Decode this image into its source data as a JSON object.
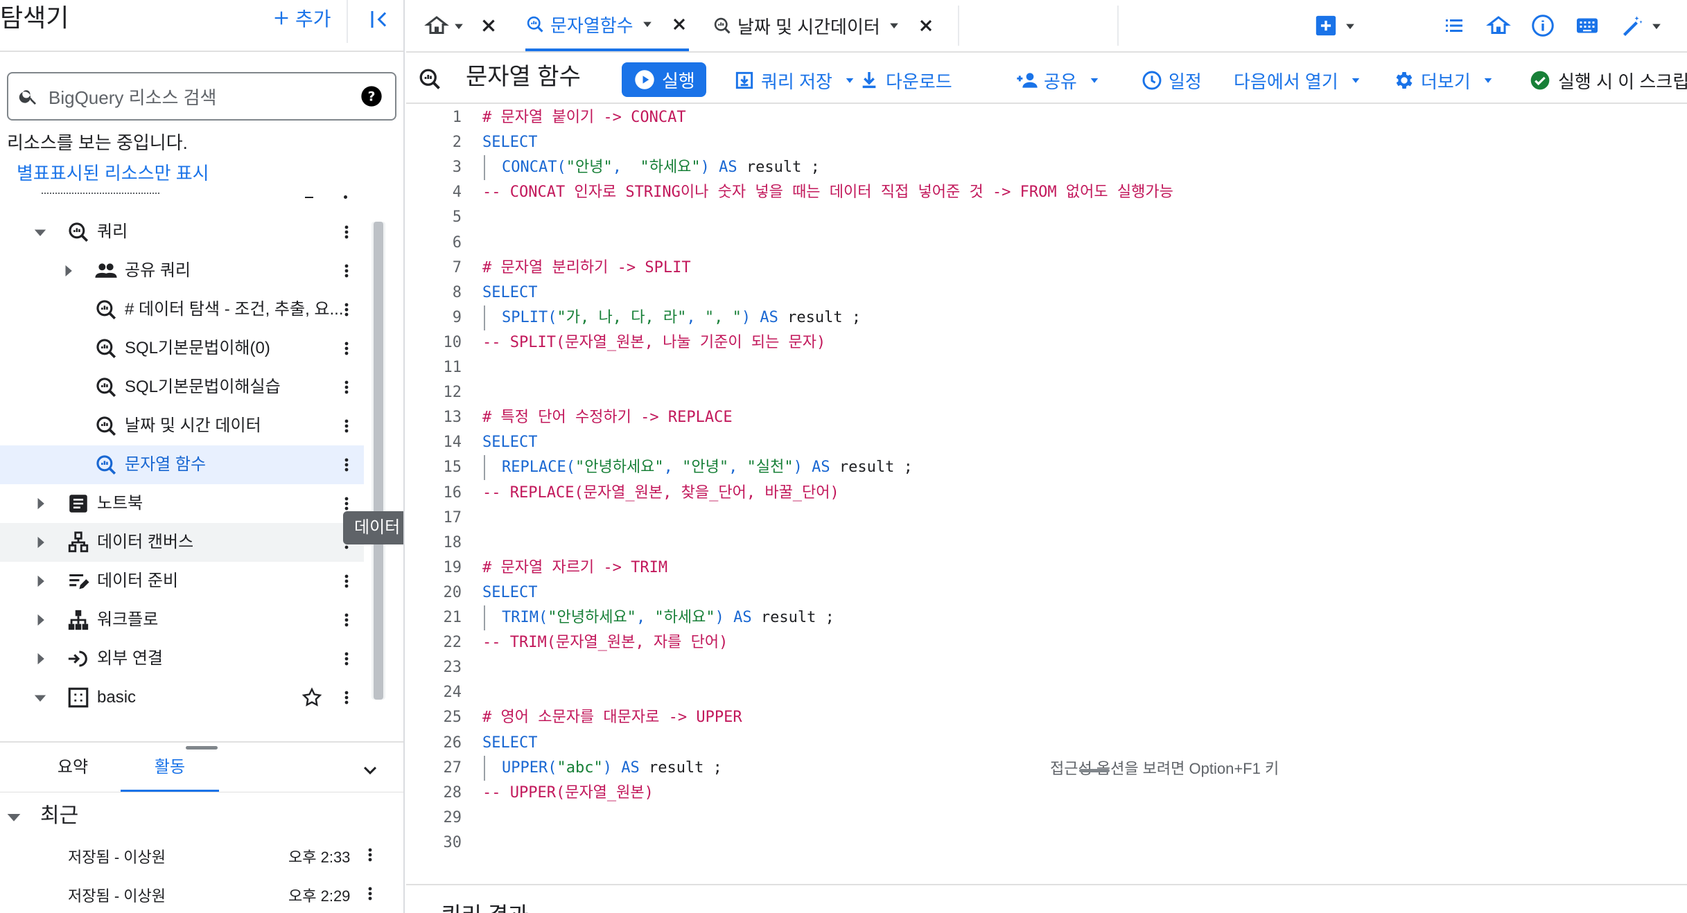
{
  "explorer": {
    "title": "탐색기",
    "add_label": "추가",
    "search_placeholder": "BigQuery 리소스 검색",
    "viewing_text": "리소스를 보는 중입니다.",
    "starred_link": "별표표시된 리소스만 표시",
    "tree": [
      {
        "label": "쿼리",
        "level": 1,
        "expanded": true,
        "icon": "query-icon"
      },
      {
        "label": "공유 쿼리",
        "level": 2,
        "expanded": false,
        "icon": "people-icon"
      },
      {
        "label": "# 데이터 탐색 - 조건, 추출, 요...",
        "level": 3,
        "icon": "query-icon"
      },
      {
        "label": "SQL기본문법이해(0)",
        "level": 3,
        "icon": "query-icon"
      },
      {
        "label": "SQL기본문법이해실습",
        "level": 3,
        "icon": "query-icon"
      },
      {
        "label": "날짜 및 시간 데이터",
        "level": 3,
        "icon": "query-icon"
      },
      {
        "label": "문자열 함수",
        "level": 3,
        "icon": "query-icon",
        "selected": true
      },
      {
        "label": "노트북",
        "level": 1,
        "expanded": false,
        "icon": "notebook-icon"
      },
      {
        "label": "데이터 캔버스",
        "level": 1,
        "expanded": false,
        "icon": "canvas-icon"
      },
      {
        "label": "데이터 준비",
        "level": 1,
        "expanded": false,
        "icon": "data-prep-icon"
      },
      {
        "label": "워크플로",
        "level": 1,
        "expanded": false,
        "icon": "workflow-icon"
      },
      {
        "label": "외부 연결",
        "level": 1,
        "expanded": false,
        "icon": "connection-icon"
      },
      {
        "label": "basic",
        "level": 1,
        "expanded": true,
        "icon": "dataset-icon"
      }
    ],
    "tooltip": "데이터 캔버스",
    "bottom_tabs": {
      "summary": "요약",
      "activity": "활동"
    },
    "recent_label": "최근",
    "activity": [
      {
        "label": "저장됨 - 이상원",
        "time": "오후 2:33"
      },
      {
        "label": "저장됨 - 이상원",
        "time": "오후 2:29"
      }
    ]
  },
  "tabs": [
    {
      "label": "문자열함수",
      "active": true
    },
    {
      "label": "날짜 및 시간데이터",
      "active": false
    }
  ],
  "toolbar": {
    "title": "문자열 함수",
    "run": "실행",
    "save": "쿼리 저장",
    "download": "다운로드",
    "share": "공유",
    "schedule": "일정",
    "open_in": "다음에서 열기",
    "more": "더보기",
    "run_check": "실행 시 이 스크립트"
  },
  "code_lines": [
    {
      "n": "1",
      "t": "cm",
      "text": "# 문자열 붙이기 -> CONCAT"
    },
    {
      "n": "2",
      "t": "kw",
      "text": "SELECT"
    },
    {
      "n": "3",
      "t": "code",
      "fn": "CONCAT(",
      "args": [
        [
          "s",
          "\"안녕\""
        ],
        [
          "f",
          ",  "
        ],
        [
          "s",
          "\"하세요\""
        ],
        [
          "f",
          ") AS "
        ],
        [
          "p",
          "result ;"
        ]
      ]
    },
    {
      "n": "4",
      "t": "cm",
      "text": "-- CONCAT 인자로 STRING이나 숫자 넣을 때는 데이터 직접 넣어준 것 -> FROM 없어도 실행가능"
    },
    {
      "n": "5",
      "t": "blank"
    },
    {
      "n": "6",
      "t": "blank"
    },
    {
      "n": "7",
      "t": "cm",
      "text": "# 문자열 분리하기 -> SPLIT"
    },
    {
      "n": "8",
      "t": "kw",
      "text": "SELECT"
    },
    {
      "n": "9",
      "t": "code",
      "fn": "SPLIT(",
      "args": [
        [
          "s",
          "\"가, 나, 다, 라\""
        ],
        [
          "f",
          ", "
        ],
        [
          "s",
          "\", \""
        ],
        [
          "f",
          ") AS "
        ],
        [
          "p",
          "result ;"
        ]
      ]
    },
    {
      "n": "10",
      "t": "cm",
      "text": "-- SPLIT(문자열_원본, 나눌 기준이 되는 문자)"
    },
    {
      "n": "11",
      "t": "blank"
    },
    {
      "n": "12",
      "t": "blank"
    },
    {
      "n": "13",
      "t": "cm",
      "text": "# 특정 단어 수정하기 -> REPLACE"
    },
    {
      "n": "14",
      "t": "kw",
      "text": "SELECT"
    },
    {
      "n": "15",
      "t": "code",
      "fn": "REPLACE(",
      "args": [
        [
          "s",
          "\"안녕하세요\""
        ],
        [
          "f",
          ", "
        ],
        [
          "s",
          "\"안녕\""
        ],
        [
          "f",
          ", "
        ],
        [
          "s",
          "\"실천\""
        ],
        [
          "f",
          ") AS "
        ],
        [
          "p",
          "result ;"
        ]
      ]
    },
    {
      "n": "16",
      "t": "cm",
      "text": "-- REPLACE(문자열_원본, 찾을_단어, 바꿀_단어)"
    },
    {
      "n": "17",
      "t": "blank"
    },
    {
      "n": "18",
      "t": "blank"
    },
    {
      "n": "19",
      "t": "cm",
      "text": "# 문자열 자르기 -> TRIM"
    },
    {
      "n": "20",
      "t": "kw",
      "text": "SELECT"
    },
    {
      "n": "21",
      "t": "code",
      "fn": "TRIM(",
      "args": [
        [
          "s",
          "\"안녕하세요\""
        ],
        [
          "f",
          ", "
        ],
        [
          "s",
          "\"하세요\""
        ],
        [
          "f",
          ") AS "
        ],
        [
          "p",
          "result ;"
        ]
      ]
    },
    {
      "n": "22",
      "t": "cm",
      "text": "-- TRIM(문자열_원본, 자를 단어)"
    },
    {
      "n": "23",
      "t": "blank"
    },
    {
      "n": "24",
      "t": "blank"
    },
    {
      "n": "25",
      "t": "cm",
      "text": "# 영어 소문자를 대문자로 -> UPPER"
    },
    {
      "n": "26",
      "t": "kw",
      "text": "SELECT"
    },
    {
      "n": "27",
      "t": "code",
      "fn": "UPPER(",
      "args": [
        [
          "s",
          "\"abc\""
        ],
        [
          "f",
          ") AS "
        ],
        [
          "p",
          "result ;"
        ]
      ]
    },
    {
      "n": "28",
      "t": "cm",
      "text": "-- UPPER(문자열_원본)"
    },
    {
      "n": "29",
      "t": "blank"
    },
    {
      "n": "30",
      "t": "blank"
    }
  ],
  "editor": {
    "a11y_hint": "접근성 옵션을 보려면 Option+F1 키"
  },
  "results": {
    "title": "쿼리 결과"
  },
  "colors": {
    "accent": "#1a73e8",
    "comment": "#c2185b",
    "string": "#188038",
    "success": "#188038"
  }
}
